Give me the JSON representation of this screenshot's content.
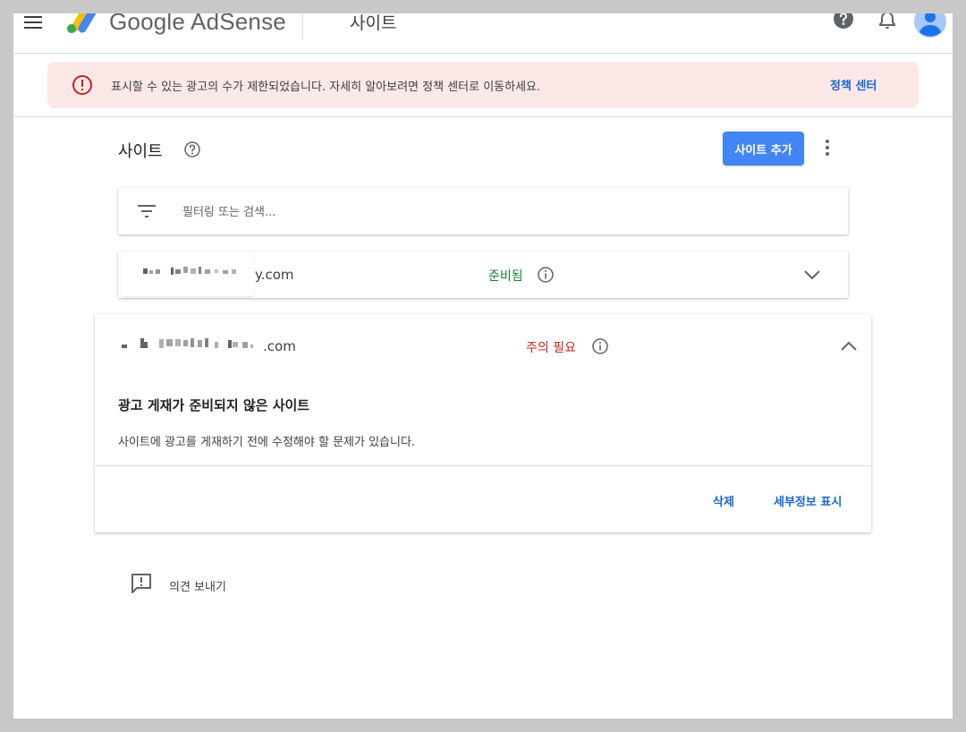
{
  "header": {
    "app_name": "Google AdSense",
    "page_heading": "사이트",
    "icons": [
      "menu-icon",
      "adsense-logo",
      "help-icon",
      "bell-icon",
      "avatar"
    ]
  },
  "alert": {
    "message": "표시할 수 있는 광고의 수가 제한되었습니다. 자세히 알아보려면 정책 센터로 이동하세요.",
    "link_label": "정책 센터",
    "background_color": "#fce8e6",
    "icon_color": "#c5221f"
  },
  "sites_section": {
    "title": "사이트",
    "add_button_label": "사이트 추가",
    "accent_color": "#4285f4"
  },
  "search": {
    "placeholder": "필터링 또는 검색..."
  },
  "sites": [
    {
      "domain_suffix": "y.com",
      "status": "준비됨",
      "status_color": "#188038",
      "expanded": false
    },
    {
      "domain_suffix": ".com",
      "status": "주의 필요",
      "status_color": "#c5221f",
      "expanded": true,
      "issue_title": "광고 게재가 준비되지 않은 사이트",
      "issue_description": "사이트에 광고를 게재하기 전에 수정해야 할 문제가 있습니다.",
      "actions": [
        "삭제",
        "세부정보 표시"
      ]
    }
  ],
  "feedback": {
    "label": "의견 보내기"
  }
}
